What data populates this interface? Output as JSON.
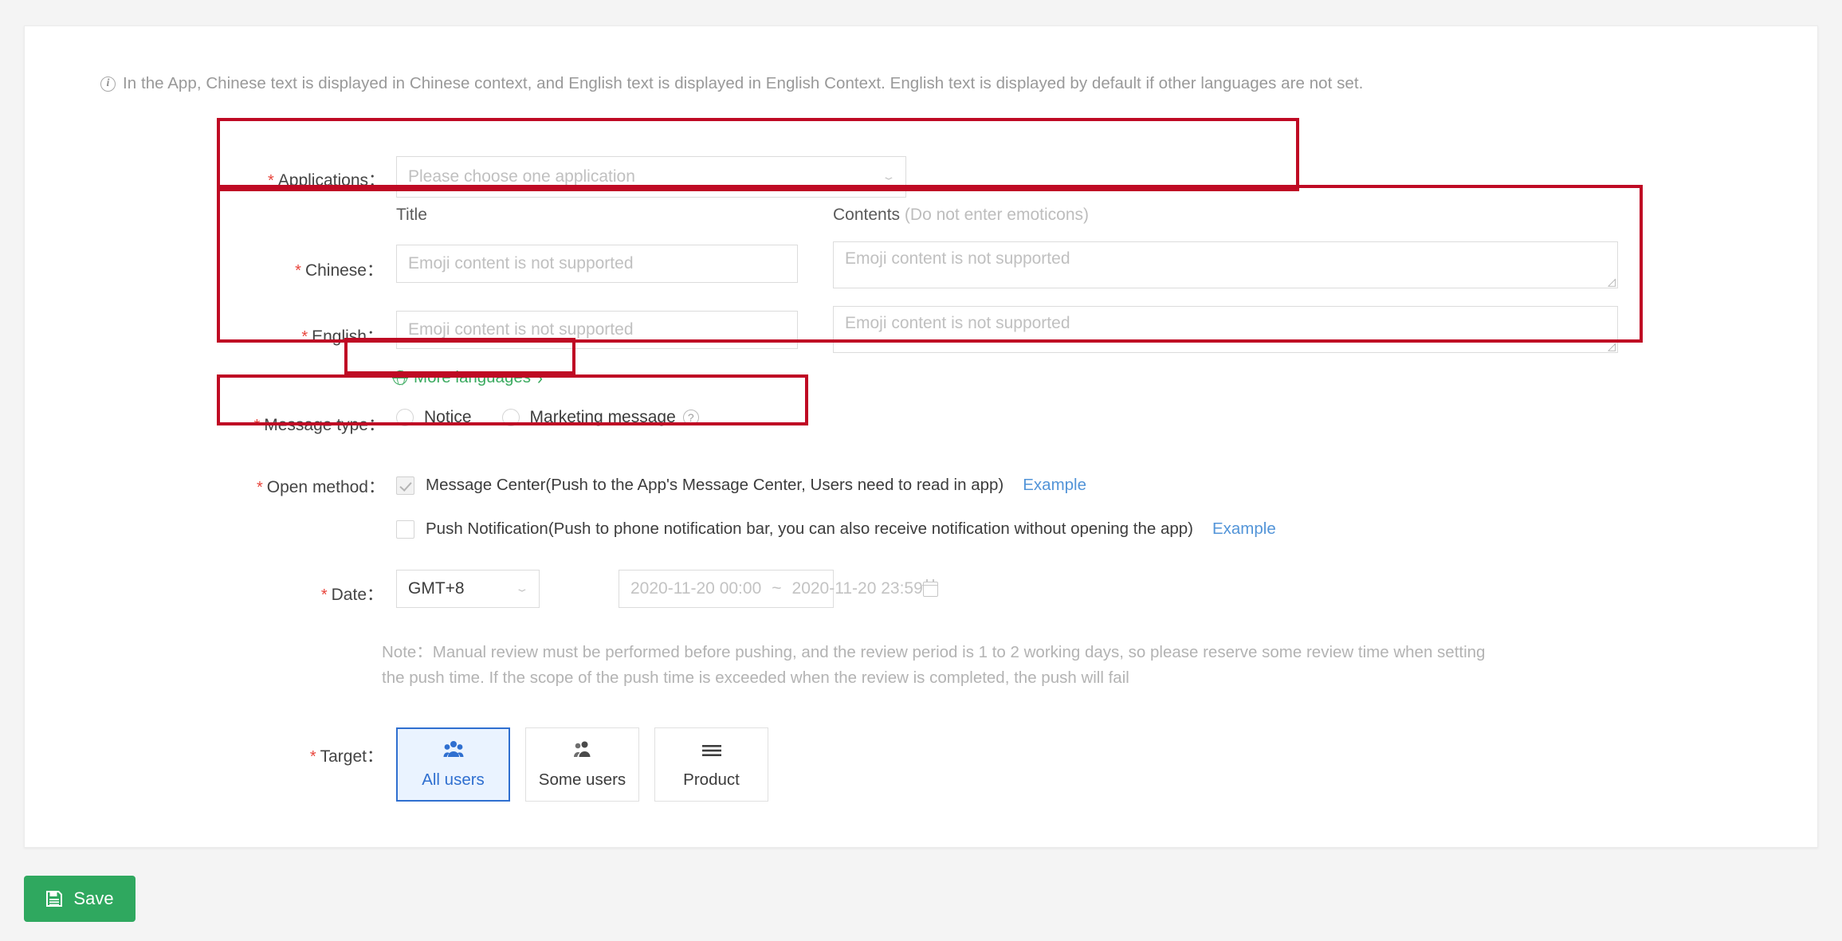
{
  "info": {
    "icon": "info-circle-icon",
    "text": "In the App, Chinese text is displayed in Chinese context, and English text is displayed in English Context. English text is displayed by default if other languages are not set."
  },
  "form": {
    "applications": {
      "label": "Applications：",
      "placeholder": "Please choose one application",
      "value": ""
    },
    "columns": {
      "title": "Title",
      "contents": "Contents",
      "contents_hint": "(Do not enter emoticons)"
    },
    "chinese": {
      "label": "Chinese：",
      "title_placeholder": "Emoji content is not supported",
      "title_value": "",
      "body_placeholder": "Emoji content is not supported",
      "body_value": ""
    },
    "english": {
      "label": "English：",
      "title_placeholder": "Emoji content is not supported",
      "title_value": "",
      "body_placeholder": "Emoji content is not supported",
      "body_value": ""
    },
    "more_languages": {
      "label": "More languages",
      "chevron": "›"
    },
    "message_type": {
      "label": "Message type：",
      "options": [
        {
          "label": "Notice",
          "selected": false
        },
        {
          "label": "Marketing message",
          "selected": false
        }
      ],
      "help": "?"
    },
    "open_method": {
      "label": "Open method：",
      "options": [
        {
          "label": "Message Center(Push to the App's Message Center, Users need to read in app)",
          "checked": true,
          "example": "Example"
        },
        {
          "label": "Push Notification(Push to phone notification bar, you can also receive notification without opening the app)",
          "checked": false,
          "example": "Example"
        }
      ]
    },
    "date": {
      "label": "Date：",
      "timezone": "GMT+8",
      "start": "2020-11-20 00:00",
      "separator": "~",
      "end": "2020-11-20 23:59"
    },
    "note": "Note：Manual review must be performed before pushing, and the review period is 1 to 2 working days, so please reserve some review time when setting the push time. If the scope of the push time is exceeded when the review is completed, the push will fail",
    "target": {
      "label": "Target：",
      "options": [
        {
          "label": "All users",
          "icon": "group-users-icon",
          "selected": true
        },
        {
          "label": "Some users",
          "icon": "two-users-icon",
          "selected": false
        },
        {
          "label": "Product",
          "icon": "list-lines-icon",
          "selected": false
        }
      ]
    }
  },
  "footer": {
    "save_label": "Save",
    "save_icon": "floppy-disk-icon"
  },
  "colors": {
    "annotation_red": "#bf0a24",
    "link_blue": "#5294d8",
    "link_green": "#3aaa5f",
    "save_green": "#2fa85f",
    "selected_blue": "#2f6fd0",
    "required_red": "#e8453c"
  }
}
